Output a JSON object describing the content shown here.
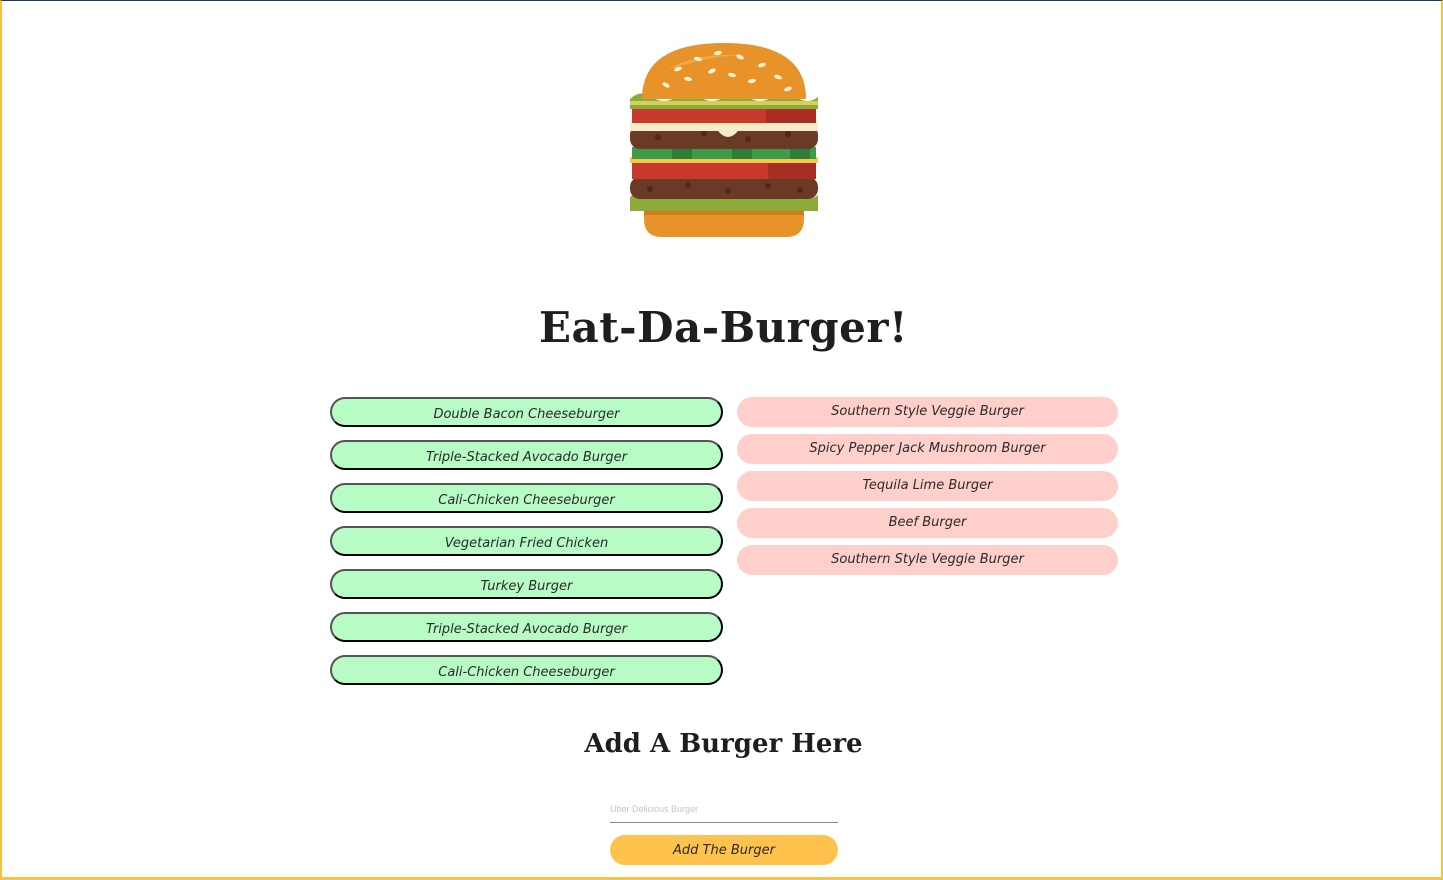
{
  "header": {
    "logo_icon": "hamburger-icon",
    "title": "Eat-Da-Burger!"
  },
  "colors": {
    "uneaten_bg": "#b8fcc5",
    "devoured_bg": "#ffd0cb",
    "button_bg": "#ffc34d",
    "frame_border": "#f5c242"
  },
  "uneaten_burgers": [
    "Double Bacon Cheeseburger",
    "Triple-Stacked Avocado Burger",
    "Cali-Chicken Cheeseburger",
    "Vegetarian Fried Chicken",
    "Turkey Burger",
    "Triple-Stacked Avocado Burger",
    "Cali-Chicken Cheeseburger"
  ],
  "devoured_burgers": [
    "Southern Style Veggie Burger",
    "Spicy Pepper Jack Mushroom Burger",
    "Tequila Lime Burger",
    "Beef Burger",
    "Southern Style Veggie Burger"
  ],
  "form": {
    "title": "Add A Burger Here",
    "input_placeholder": "Uber Delicious Burger",
    "input_value": "",
    "submit_label": "Add The Burger"
  }
}
